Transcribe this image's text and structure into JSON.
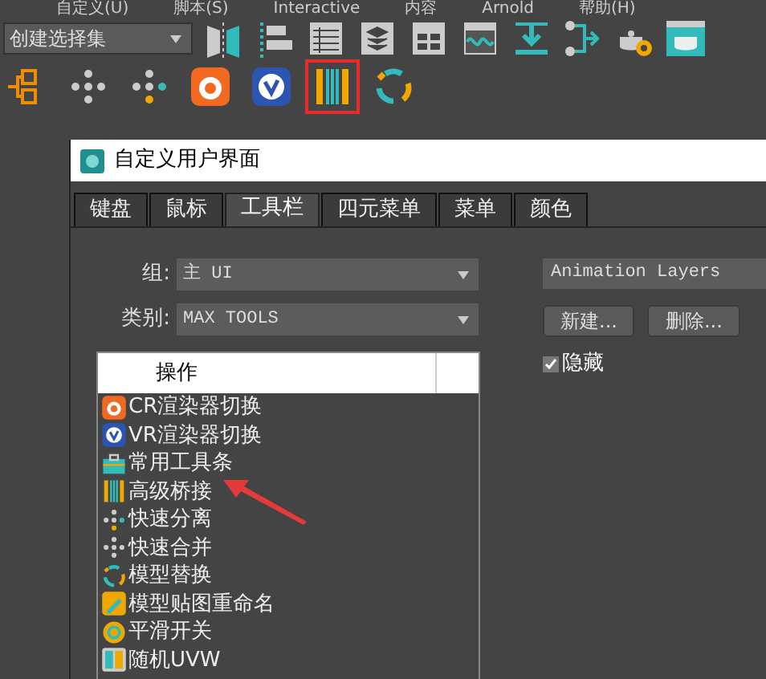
{
  "menu": [
    {
      "label": "自定义(U)"
    },
    {
      "label": "脚本(S)"
    },
    {
      "label": "Interactive"
    },
    {
      "label": "内容"
    },
    {
      "label": "Arnold"
    },
    {
      "label": "帮助(H)"
    }
  ],
  "toolbar": {
    "selection_set": "创建选择集",
    "row1": [
      {
        "kind": "mirror"
      },
      {
        "kind": "align"
      },
      {
        "kind": "list"
      },
      {
        "kind": "layers"
      },
      {
        "kind": "schematic"
      },
      {
        "kind": "curve"
      },
      {
        "kind": "import"
      },
      {
        "kind": "graph"
      },
      {
        "kind": "teapot-gear"
      },
      {
        "kind": "teapot-render"
      }
    ],
    "row2": [
      {
        "kind": "connector",
        "selected": false
      },
      {
        "kind": "dots",
        "selected": false
      },
      {
        "kind": "dots-color",
        "selected": false
      },
      {
        "kind": "cr",
        "selected": false
      },
      {
        "kind": "vr",
        "selected": false
      },
      {
        "kind": "bridge",
        "selected": true
      },
      {
        "kind": "recycle",
        "selected": false
      }
    ]
  },
  "dialog": {
    "title": "自定义用户界面",
    "tabs": [
      {
        "label": "键盘",
        "selected": false
      },
      {
        "label": "鼠标",
        "selected": false
      },
      {
        "label": "工具栏",
        "selected": true
      },
      {
        "label": "四元菜单",
        "selected": false
      },
      {
        "label": "菜单",
        "selected": false
      },
      {
        "label": "颜色",
        "selected": false
      }
    ],
    "group_label": "组:",
    "group_value": "主 UI",
    "category_label": "类别:",
    "category_value": "MAX TOOLS",
    "actions_header": "操作",
    "actions": [
      {
        "label": "CR渲染器切换",
        "kind": "cr"
      },
      {
        "label": "VR渲染器切换",
        "kind": "vr"
      },
      {
        "label": "常用工具条",
        "kind": "toolbox"
      },
      {
        "label": "高级桥接",
        "kind": "bridge"
      },
      {
        "label": "快速分离",
        "kind": "dots-color"
      },
      {
        "label": "快速合并",
        "kind": "dots"
      },
      {
        "label": "模型替换",
        "kind": "recycle"
      },
      {
        "label": "模型贴图重命名",
        "kind": "pencil"
      },
      {
        "label": "平滑开关",
        "kind": "ring"
      },
      {
        "label": "随机UVW",
        "kind": "uvw"
      }
    ],
    "toolbar_name": "Animation Layers",
    "buttons": [
      "新建...",
      "删除..."
    ],
    "hide": {
      "label": "隐藏",
      "checked": true
    }
  }
}
